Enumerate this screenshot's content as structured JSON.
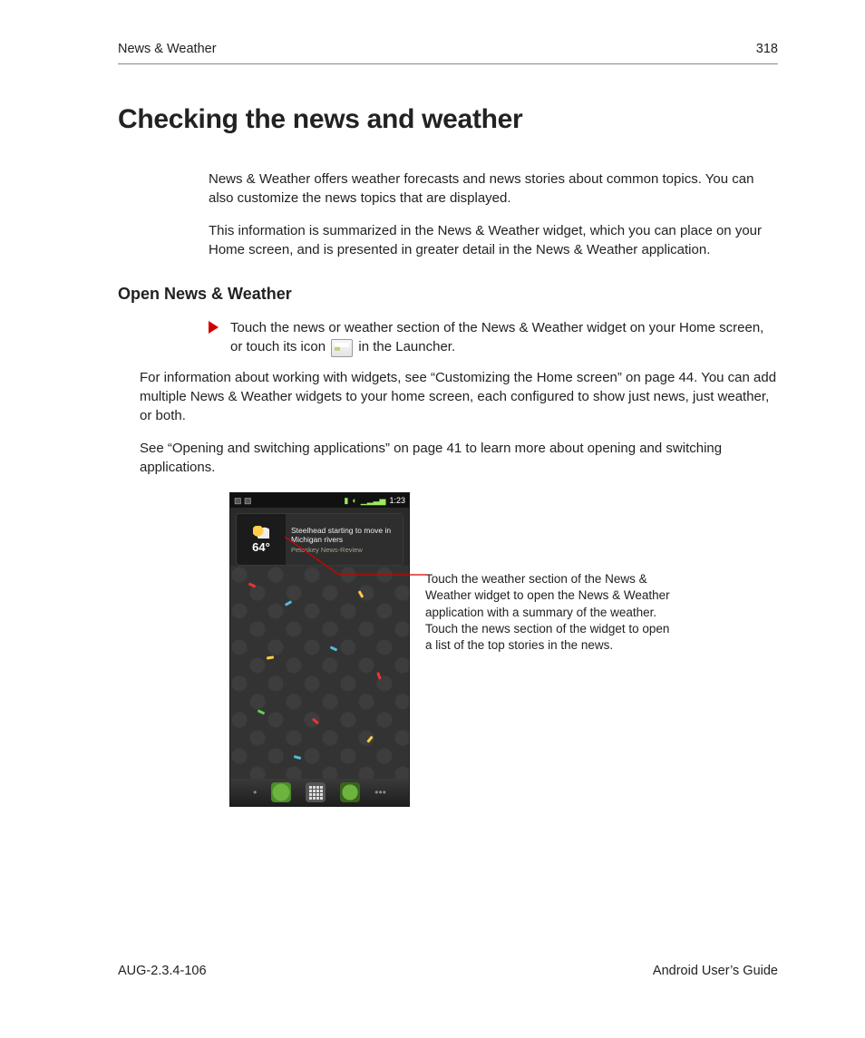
{
  "header": {
    "section": "News & Weather",
    "page": "318"
  },
  "title": "Checking the news and weather",
  "intro": [
    "News & Weather offers weather forecasts and news stories about common topics. You can also customize the news topics that are displayed.",
    "This information is summarized in the News & Weather widget, which you can place on your Home screen, and is presented in greater detail in the News & Weather application."
  ],
  "section_h2": "Open News & Weather",
  "step": {
    "line_before_icon": "Touch the news or weather section of the News & Weather widget on your Home screen, or touch its icon ",
    "line_after_icon": " in the Launcher."
  },
  "continuation": [
    "For information about working with widgets, see “Customizing the Home screen” on page 44. You can add multiple News & Weather widgets to your home screen, each configured to show just news, just weather, or both.",
    "See “Opening and switching applications” on page 41 to learn more about opening and switching applications."
  ],
  "callout": "Touch the weather section of the News & Weather widget to open the News & Weather application with a summary of the weather. Touch the news section of the widget to open a list of the top stories in the news.",
  "screenshot": {
    "status_time": "1:23",
    "temp": "64°",
    "headline": "Steelhead starting to move in Michigan rivers",
    "source": "Petoskey News-Review"
  },
  "footer": {
    "left": "AUG-2.3.4-106",
    "right": "Android User’s Guide"
  }
}
